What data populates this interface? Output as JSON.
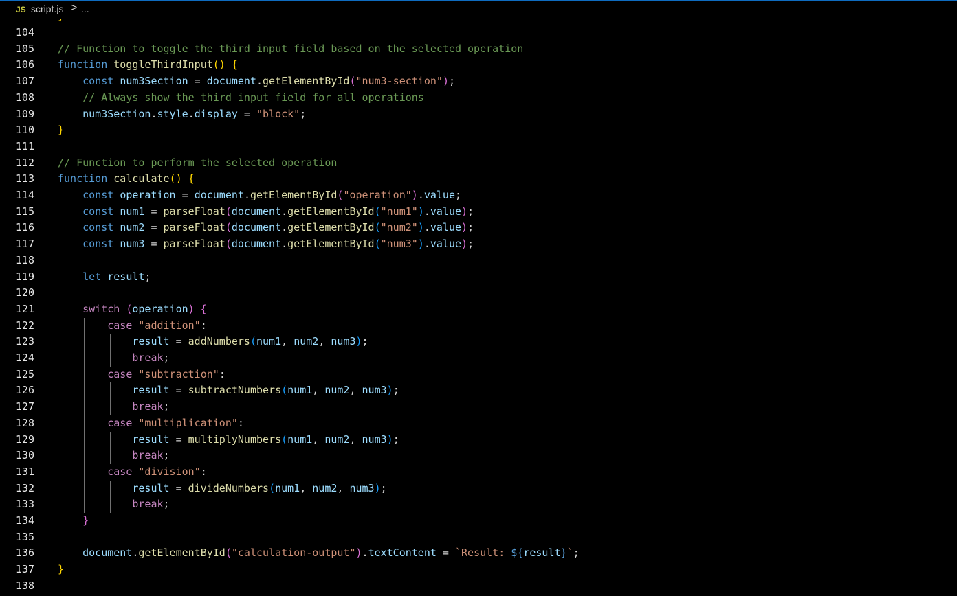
{
  "breadcrumb": {
    "icon_label": "JS",
    "file": "script.js",
    "separator": ">",
    "more": "..."
  },
  "colors": {
    "comment": "#6a9955",
    "keyword": "#569cd6",
    "control": "#c586c0",
    "variable": "#9cdcfe",
    "function": "#dcdcaa",
    "string": "#ce9178",
    "punct": "#d4d4d4",
    "bracket_gold": "#ffd700",
    "bracket_pink": "#da70d6",
    "bracket_blue": "#179fff",
    "js_icon": "#cbcb41"
  },
  "editor": {
    "hidden_above": "}",
    "lines": [
      {
        "n": "104",
        "tokens": []
      },
      {
        "n": "105",
        "tokens": [
          [
            "// Function to toggle the third input field based on the selected operation",
            "comment"
          ]
        ]
      },
      {
        "n": "106",
        "tokens": [
          [
            "function",
            "keyword"
          ],
          [
            " ",
            "punct"
          ],
          [
            "toggleThirdInput",
            "function"
          ],
          [
            "()",
            "bracket_gold"
          ],
          [
            " ",
            "punct"
          ],
          [
            "{",
            "bracket_gold"
          ]
        ]
      },
      {
        "n": "107",
        "tokens": [
          [
            "    ",
            "punct"
          ],
          [
            "const",
            "keyword"
          ],
          [
            " ",
            "punct"
          ],
          [
            "num3Section",
            "variable"
          ],
          [
            " = ",
            "punct"
          ],
          [
            "document",
            "variable"
          ],
          [
            ".",
            "punct"
          ],
          [
            "getElementById",
            "function"
          ],
          [
            "(",
            "bracket_pink"
          ],
          [
            "\"num3-section\"",
            "string"
          ],
          [
            ")",
            "bracket_pink"
          ],
          [
            ";",
            "punct"
          ]
        ]
      },
      {
        "n": "108",
        "tokens": [
          [
            "    ",
            "punct"
          ],
          [
            "// Always show the third input field for all operations",
            "comment"
          ]
        ]
      },
      {
        "n": "109",
        "tokens": [
          [
            "    ",
            "punct"
          ],
          [
            "num3Section",
            "variable"
          ],
          [
            ".",
            "punct"
          ],
          [
            "style",
            "variable"
          ],
          [
            ".",
            "punct"
          ],
          [
            "display",
            "variable"
          ],
          [
            " = ",
            "punct"
          ],
          [
            "\"block\"",
            "string"
          ],
          [
            ";",
            "punct"
          ]
        ]
      },
      {
        "n": "110",
        "tokens": [
          [
            "}",
            "bracket_gold"
          ]
        ]
      },
      {
        "n": "111",
        "tokens": []
      },
      {
        "n": "112",
        "tokens": [
          [
            "// Function to perform the selected operation",
            "comment"
          ]
        ]
      },
      {
        "n": "113",
        "tokens": [
          [
            "function",
            "keyword"
          ],
          [
            " ",
            "punct"
          ],
          [
            "calculate",
            "function"
          ],
          [
            "()",
            "bracket_gold"
          ],
          [
            " ",
            "punct"
          ],
          [
            "{",
            "bracket_gold"
          ]
        ]
      },
      {
        "n": "114",
        "tokens": [
          [
            "    ",
            "punct"
          ],
          [
            "const",
            "keyword"
          ],
          [
            " ",
            "punct"
          ],
          [
            "operation",
            "variable"
          ],
          [
            " = ",
            "punct"
          ],
          [
            "document",
            "variable"
          ],
          [
            ".",
            "punct"
          ],
          [
            "getElementById",
            "function"
          ],
          [
            "(",
            "bracket_pink"
          ],
          [
            "\"operation\"",
            "string"
          ],
          [
            ")",
            "bracket_pink"
          ],
          [
            ".",
            "punct"
          ],
          [
            "value",
            "variable"
          ],
          [
            ";",
            "punct"
          ]
        ]
      },
      {
        "n": "115",
        "tokens": [
          [
            "    ",
            "punct"
          ],
          [
            "const",
            "keyword"
          ],
          [
            " ",
            "punct"
          ],
          [
            "num1",
            "variable"
          ],
          [
            " = ",
            "punct"
          ],
          [
            "parseFloat",
            "function"
          ],
          [
            "(",
            "bracket_pink"
          ],
          [
            "document",
            "variable"
          ],
          [
            ".",
            "punct"
          ],
          [
            "getElementById",
            "function"
          ],
          [
            "(",
            "bracket_blue"
          ],
          [
            "\"num1\"",
            "string"
          ],
          [
            ")",
            "bracket_blue"
          ],
          [
            ".",
            "punct"
          ],
          [
            "value",
            "variable"
          ],
          [
            ")",
            "bracket_pink"
          ],
          [
            ";",
            "punct"
          ]
        ]
      },
      {
        "n": "116",
        "tokens": [
          [
            "    ",
            "punct"
          ],
          [
            "const",
            "keyword"
          ],
          [
            " ",
            "punct"
          ],
          [
            "num2",
            "variable"
          ],
          [
            " = ",
            "punct"
          ],
          [
            "parseFloat",
            "function"
          ],
          [
            "(",
            "bracket_pink"
          ],
          [
            "document",
            "variable"
          ],
          [
            ".",
            "punct"
          ],
          [
            "getElementById",
            "function"
          ],
          [
            "(",
            "bracket_blue"
          ],
          [
            "\"num2\"",
            "string"
          ],
          [
            ")",
            "bracket_blue"
          ],
          [
            ".",
            "punct"
          ],
          [
            "value",
            "variable"
          ],
          [
            ")",
            "bracket_pink"
          ],
          [
            ";",
            "punct"
          ]
        ]
      },
      {
        "n": "117",
        "tokens": [
          [
            "    ",
            "punct"
          ],
          [
            "const",
            "keyword"
          ],
          [
            " ",
            "punct"
          ],
          [
            "num3",
            "variable"
          ],
          [
            " = ",
            "punct"
          ],
          [
            "parseFloat",
            "function"
          ],
          [
            "(",
            "bracket_pink"
          ],
          [
            "document",
            "variable"
          ],
          [
            ".",
            "punct"
          ],
          [
            "getElementById",
            "function"
          ],
          [
            "(",
            "bracket_blue"
          ],
          [
            "\"num3\"",
            "string"
          ],
          [
            ")",
            "bracket_blue"
          ],
          [
            ".",
            "punct"
          ],
          [
            "value",
            "variable"
          ],
          [
            ")",
            "bracket_pink"
          ],
          [
            ";",
            "punct"
          ]
        ]
      },
      {
        "n": "118",
        "tokens": []
      },
      {
        "n": "119",
        "tokens": [
          [
            "    ",
            "punct"
          ],
          [
            "let",
            "keyword"
          ],
          [
            " ",
            "punct"
          ],
          [
            "result",
            "variable"
          ],
          [
            ";",
            "punct"
          ]
        ]
      },
      {
        "n": "120",
        "tokens": []
      },
      {
        "n": "121",
        "tokens": [
          [
            "    ",
            "punct"
          ],
          [
            "switch",
            "control"
          ],
          [
            " ",
            "punct"
          ],
          [
            "(",
            "bracket_pink"
          ],
          [
            "operation",
            "variable"
          ],
          [
            ")",
            "bracket_pink"
          ],
          [
            " ",
            "punct"
          ],
          [
            "{",
            "bracket_pink"
          ]
        ]
      },
      {
        "n": "122",
        "tokens": [
          [
            "        ",
            "punct"
          ],
          [
            "case",
            "control"
          ],
          [
            " ",
            "punct"
          ],
          [
            "\"addition\"",
            "string"
          ],
          [
            ":",
            "punct"
          ]
        ]
      },
      {
        "n": "123",
        "tokens": [
          [
            "            ",
            "punct"
          ],
          [
            "result",
            "variable"
          ],
          [
            " = ",
            "punct"
          ],
          [
            "addNumbers",
            "function"
          ],
          [
            "(",
            "bracket_blue"
          ],
          [
            "num1",
            "variable"
          ],
          [
            ", ",
            "punct"
          ],
          [
            "num2",
            "variable"
          ],
          [
            ", ",
            "punct"
          ],
          [
            "num3",
            "variable"
          ],
          [
            ")",
            "bracket_blue"
          ],
          [
            ";",
            "punct"
          ]
        ]
      },
      {
        "n": "124",
        "tokens": [
          [
            "            ",
            "punct"
          ],
          [
            "break",
            "control"
          ],
          [
            ";",
            "punct"
          ]
        ]
      },
      {
        "n": "125",
        "tokens": [
          [
            "        ",
            "punct"
          ],
          [
            "case",
            "control"
          ],
          [
            " ",
            "punct"
          ],
          [
            "\"subtraction\"",
            "string"
          ],
          [
            ":",
            "punct"
          ]
        ]
      },
      {
        "n": "126",
        "tokens": [
          [
            "            ",
            "punct"
          ],
          [
            "result",
            "variable"
          ],
          [
            " = ",
            "punct"
          ],
          [
            "subtractNumbers",
            "function"
          ],
          [
            "(",
            "bracket_blue"
          ],
          [
            "num1",
            "variable"
          ],
          [
            ", ",
            "punct"
          ],
          [
            "num2",
            "variable"
          ],
          [
            ", ",
            "punct"
          ],
          [
            "num3",
            "variable"
          ],
          [
            ")",
            "bracket_blue"
          ],
          [
            ";",
            "punct"
          ]
        ]
      },
      {
        "n": "127",
        "tokens": [
          [
            "            ",
            "punct"
          ],
          [
            "break",
            "control"
          ],
          [
            ";",
            "punct"
          ]
        ]
      },
      {
        "n": "128",
        "tokens": [
          [
            "        ",
            "punct"
          ],
          [
            "case",
            "control"
          ],
          [
            " ",
            "punct"
          ],
          [
            "\"multiplication\"",
            "string"
          ],
          [
            ":",
            "punct"
          ]
        ]
      },
      {
        "n": "129",
        "tokens": [
          [
            "            ",
            "punct"
          ],
          [
            "result",
            "variable"
          ],
          [
            " = ",
            "punct"
          ],
          [
            "multiplyNumbers",
            "function"
          ],
          [
            "(",
            "bracket_blue"
          ],
          [
            "num1",
            "variable"
          ],
          [
            ", ",
            "punct"
          ],
          [
            "num2",
            "variable"
          ],
          [
            ", ",
            "punct"
          ],
          [
            "num3",
            "variable"
          ],
          [
            ")",
            "bracket_blue"
          ],
          [
            ";",
            "punct"
          ]
        ]
      },
      {
        "n": "130",
        "tokens": [
          [
            "            ",
            "punct"
          ],
          [
            "break",
            "control"
          ],
          [
            ";",
            "punct"
          ]
        ]
      },
      {
        "n": "131",
        "tokens": [
          [
            "        ",
            "punct"
          ],
          [
            "case",
            "control"
          ],
          [
            " ",
            "punct"
          ],
          [
            "\"division\"",
            "string"
          ],
          [
            ":",
            "punct"
          ]
        ]
      },
      {
        "n": "132",
        "tokens": [
          [
            "            ",
            "punct"
          ],
          [
            "result",
            "variable"
          ],
          [
            " = ",
            "punct"
          ],
          [
            "divideNumbers",
            "function"
          ],
          [
            "(",
            "bracket_blue"
          ],
          [
            "num1",
            "variable"
          ],
          [
            ", ",
            "punct"
          ],
          [
            "num2",
            "variable"
          ],
          [
            ", ",
            "punct"
          ],
          [
            "num3",
            "variable"
          ],
          [
            ")",
            "bracket_blue"
          ],
          [
            ";",
            "punct"
          ]
        ]
      },
      {
        "n": "133",
        "tokens": [
          [
            "            ",
            "punct"
          ],
          [
            "break",
            "control"
          ],
          [
            ";",
            "punct"
          ]
        ]
      },
      {
        "n": "134",
        "tokens": [
          [
            "    ",
            "punct"
          ],
          [
            "}",
            "bracket_pink"
          ]
        ]
      },
      {
        "n": "135",
        "tokens": []
      },
      {
        "n": "136",
        "tokens": [
          [
            "    ",
            "punct"
          ],
          [
            "document",
            "variable"
          ],
          [
            ".",
            "punct"
          ],
          [
            "getElementById",
            "function"
          ],
          [
            "(",
            "bracket_pink"
          ],
          [
            "\"calculation-output\"",
            "string"
          ],
          [
            ")",
            "bracket_pink"
          ],
          [
            ".",
            "punct"
          ],
          [
            "textContent",
            "variable"
          ],
          [
            " = ",
            "punct"
          ],
          [
            "`Result: ",
            "string"
          ],
          [
            "${",
            "keyword"
          ],
          [
            "result",
            "variable"
          ],
          [
            "}",
            "keyword"
          ],
          [
            "`",
            "string"
          ],
          [
            ";",
            "punct"
          ]
        ]
      },
      {
        "n": "137",
        "tokens": [
          [
            "}",
            "bracket_gold"
          ]
        ]
      },
      {
        "n": "138",
        "tokens": []
      }
    ]
  }
}
